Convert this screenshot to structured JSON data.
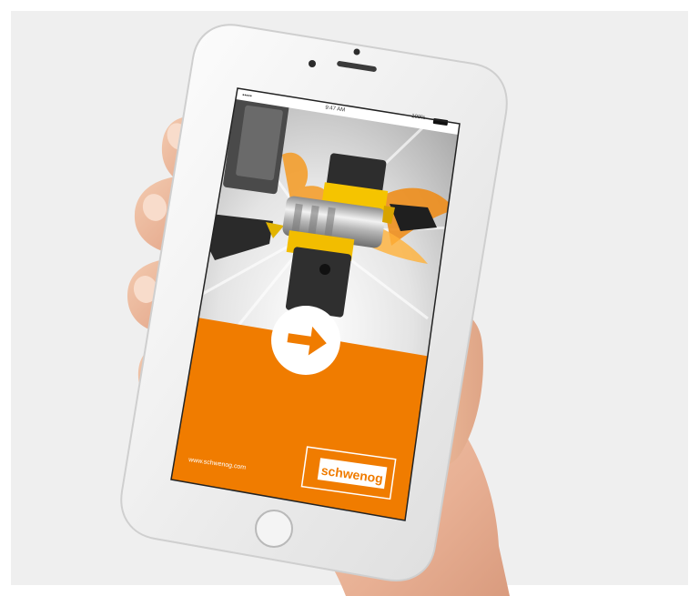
{
  "status_bar": {
    "carrier": "•••••",
    "time": "9:47 AM",
    "battery": "100%"
  },
  "screen": {
    "url": "www.schwenog.com",
    "brand_logo": "schwenog",
    "action_icon": "right-arrow-icon"
  },
  "colors": {
    "accent_orange": "#f07c00",
    "backdrop": "#efefef",
    "phone_body": "#f6f6f6"
  }
}
